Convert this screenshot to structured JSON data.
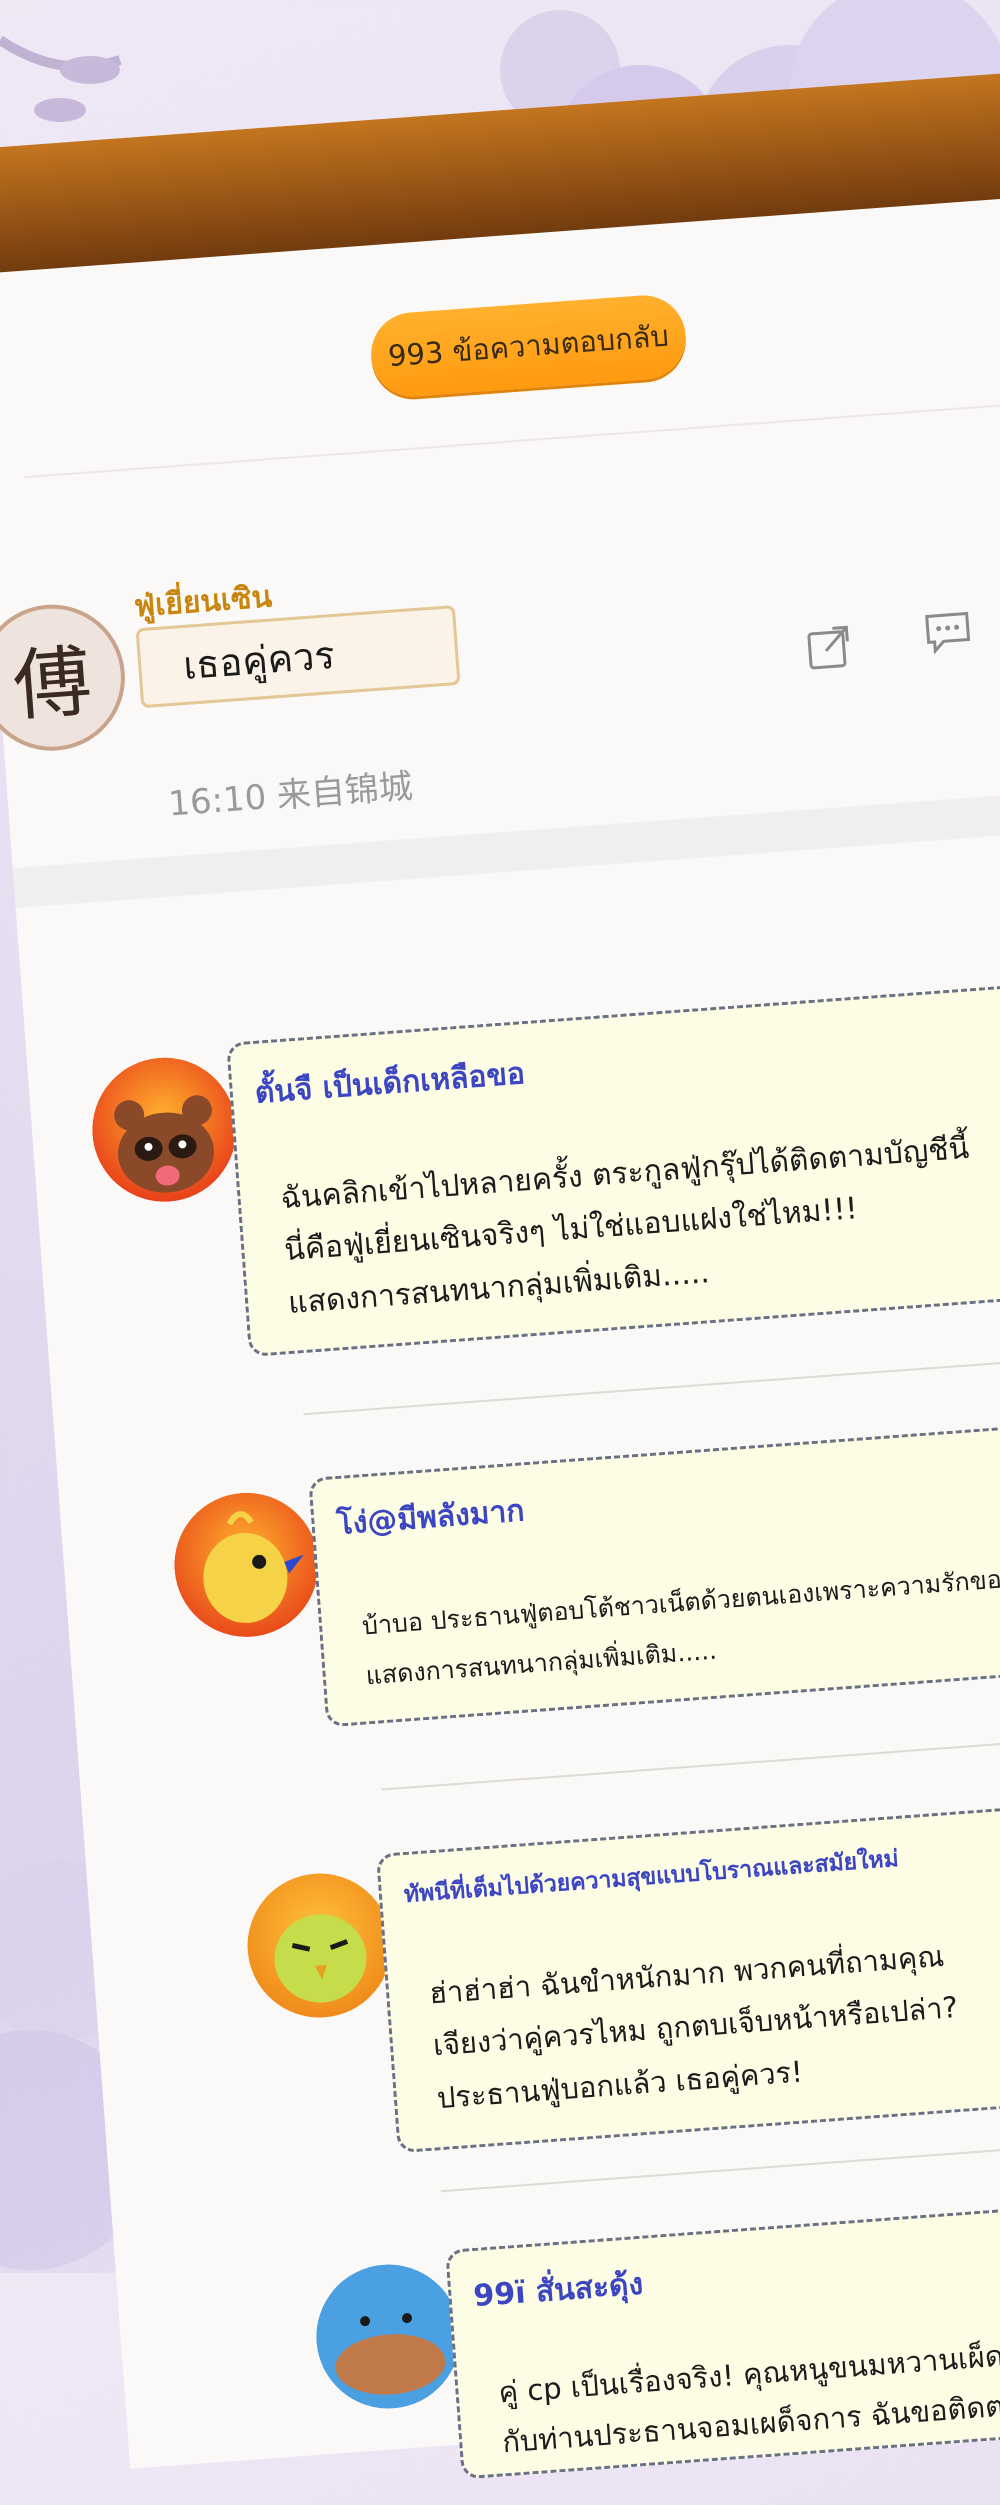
{
  "reply_count_badge": "993 ข้อความตอบกลับ",
  "post": {
    "author_name": "ฟู่เยี่ยนเซิน",
    "avatar_char": "傅",
    "content": "เธอคู่ควร",
    "timestamp": "16:10 来自锦城"
  },
  "icons": {
    "share": "share-icon",
    "comment": "comment-icon"
  },
  "comments": [
    {
      "username": "ตั้นจื เป็นเด็กเหลือขอ",
      "avatar": "raccoon-avatar",
      "text": "ฉันคลิกเข้าไปหลายครั้ง ตระกูลฟู่กรุ๊ปได้ติดตามบัญชีนี้\nนี่คือฟู่เยี่ยนเซินจริงๆ ไม่ใช่แอบแฝงใช่ไหม!!!",
      "more": "แสดงการสนทนากลุ่มเพิ่มเติม....."
    },
    {
      "username": "โง่@มีพลังมาก",
      "avatar": "chick-avatar",
      "text": "บ้าบอ ประธานฟู่ตอบโต้ชาวเน็ตด้วยตนเองเพราะความรักของเขา",
      "more": "แสดงการสนทนากลุ่มเพิ่มเติม....."
    },
    {
      "username": "ทัพนีที่เต็มไปด้วยความสุขแบบโบราณและสมัยใหม่",
      "avatar": "green-bird-avatar",
      "text": "ฮ่าฮ่าฮ่า ฉันขำหนักมาก พวกคนที่ถามคุณ\nเจียงว่าคู่ควรไหม  ถูกตบเจ็บหน้าหรือเปล่า?\nประธานฟู่บอกแล้ว เธอคู่ควร!",
      "more": ""
    },
    {
      "username": "99ï สั่นสะดุ้ง",
      "avatar": "fish-avatar",
      "text": "คู่ cp เป็นเรื่องจริง! คุณหนูขนมหวานเผ็ดร้อน\nกับท่านประธานจอมเผด็จการ ฉันขอติดตาม!",
      "more": ""
    }
  ],
  "colors": {
    "badge": "#ff9a10",
    "username": "#3c46c2",
    "author": "#c9860f",
    "bubble": "#fdfce4",
    "wood": "#8a4a12"
  }
}
